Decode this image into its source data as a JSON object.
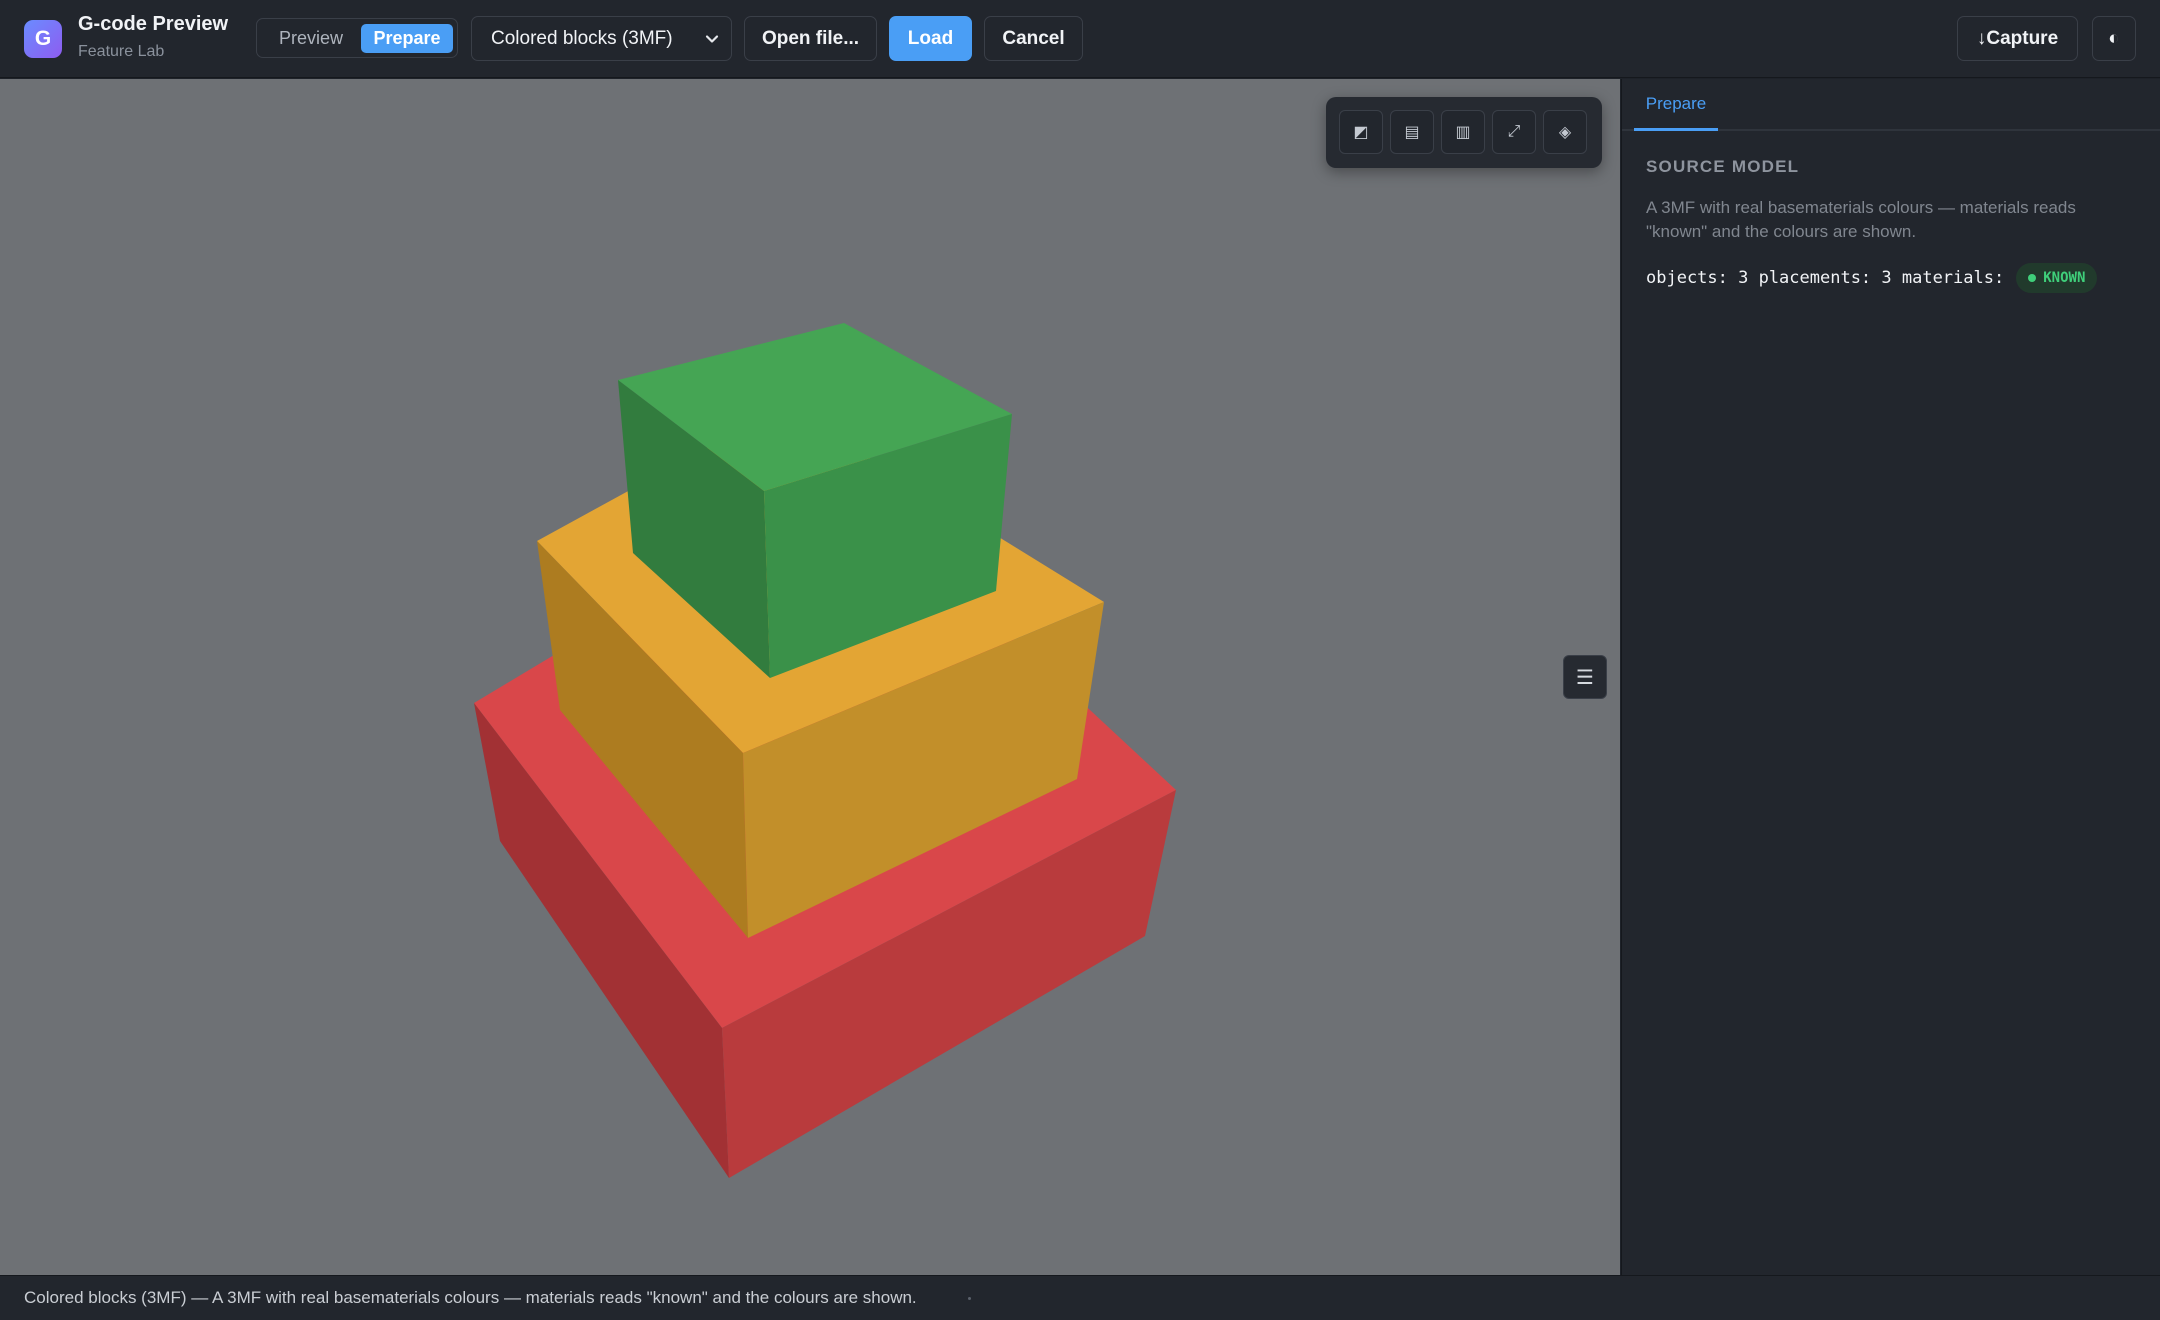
{
  "app": {
    "title": "G-code Preview",
    "subtitle": "Feature Lab",
    "logo_letter": "G"
  },
  "mode_tabs": {
    "preview": "Preview",
    "prepare": "Prepare",
    "active": "Prepare"
  },
  "model_select": {
    "value": "Colored blocks (3MF)"
  },
  "toolbar": {
    "open_label": "Open file...",
    "load_label": "Load",
    "cancel_label": "Cancel",
    "capture_label": "↓Capture",
    "theme_icon": "◐"
  },
  "view_tools": [
    {
      "name": "shading-icon",
      "glyph": "◩"
    },
    {
      "name": "layers-icon",
      "glyph": "▤"
    },
    {
      "name": "columns-icon",
      "glyph": "▥"
    },
    {
      "name": "expand-icon",
      "glyph": "⤢"
    },
    {
      "name": "reset-view-icon",
      "glyph": "◈"
    }
  ],
  "side_toggle_icon": "☰",
  "panel": {
    "tab": "Prepare",
    "section_title": "SOURCE MODEL",
    "description": "A 3MF with real basematerials colours — materials reads \"known\" and the colours are shown.",
    "stats": "objects: 3 placements: 3 materials:",
    "materials_badge": "KNOWN"
  },
  "colors": {
    "accent": "#4a9ef5",
    "block_red": "#d9474a",
    "block_orange": "#e0a232",
    "block_green": "#43a151",
    "viewport_bg": "#6e7175"
  },
  "status": {
    "text": "Colored blocks (3MF) — A 3MF with real basematerials colours — materials reads \"known\" and the colours are shown."
  }
}
